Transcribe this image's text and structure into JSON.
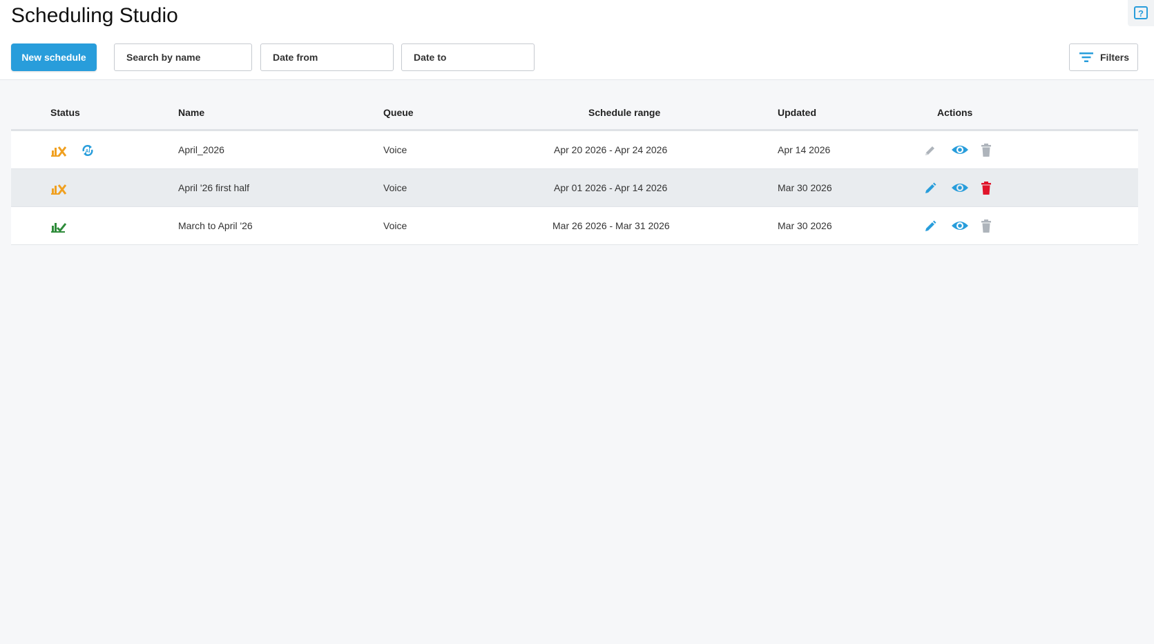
{
  "header": {
    "title": "Scheduling Studio",
    "new_button": "New schedule",
    "search": "Search by name",
    "date_from": "Date from",
    "date_to": "Date to",
    "filters": "Filters",
    "help_icon": "help-icon"
  },
  "colors": {
    "accent": "#289ddb",
    "warning": "#f0a020",
    "success": "#2e8b3a",
    "danger": "#e0142a",
    "disabled": "#aeb4bb"
  },
  "table": {
    "columns": [
      "Status",
      "Name",
      "Queue",
      "Schedule range",
      "Updated",
      "Actions"
    ],
    "rows": [
      {
        "status_icons": [
          "chart-warning-icon",
          "sync-icon"
        ],
        "name": "April_2026",
        "queue": "Voice",
        "range": "Apr 20 2026 - Apr 24 2026",
        "updated": "Apr 14 2026",
        "actions": {
          "edit": "disabled",
          "view": "enabled",
          "delete": "disabled"
        }
      },
      {
        "status_icons": [
          "chart-warning-icon"
        ],
        "name": "April '26 first half",
        "queue": "Voice",
        "range": "Apr 01 2026 - Apr 14 2026",
        "updated": "Mar 30 2026",
        "actions": {
          "edit": "enabled",
          "view": "enabled",
          "delete": "enabled"
        }
      },
      {
        "status_icons": [
          "chart-success-icon"
        ],
        "name": "March to April '26",
        "queue": "Voice",
        "range": "Mar 26 2026 - Mar 31 2026",
        "updated": "Mar 30 2026",
        "actions": {
          "edit": "enabled",
          "view": "enabled",
          "delete": "disabled"
        }
      }
    ]
  }
}
